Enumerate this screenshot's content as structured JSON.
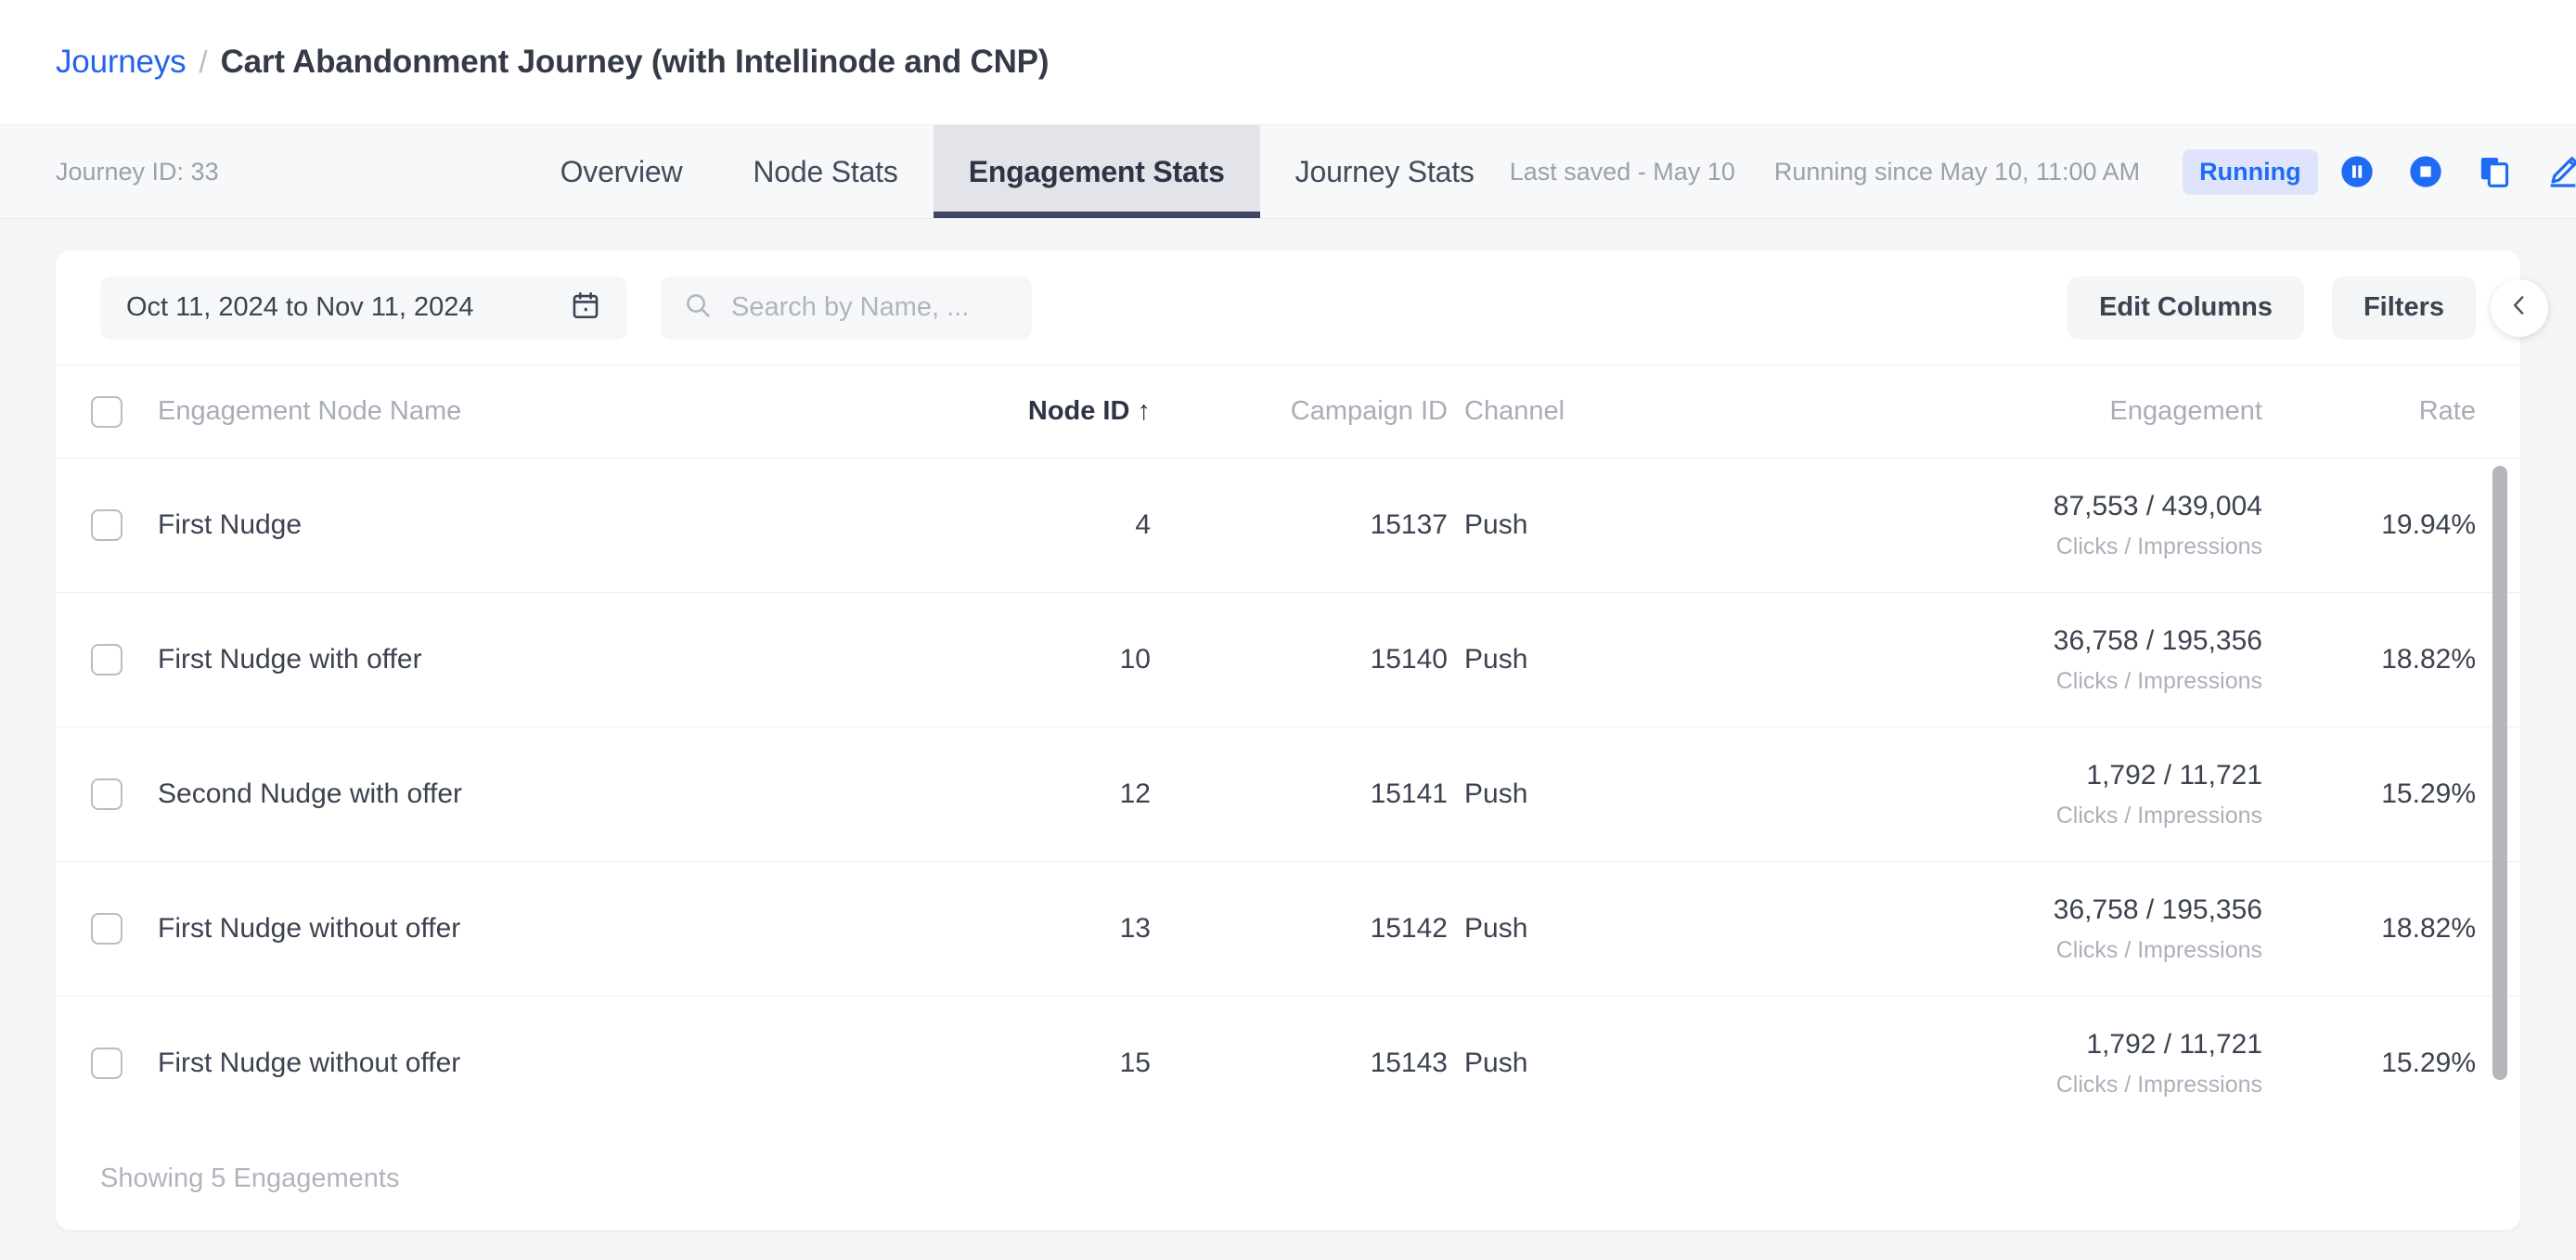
{
  "breadcrumb": {
    "parent": "Journeys",
    "separator": "/",
    "current": "Cart Abandonment Journey (with Intellinode and CNP)"
  },
  "tabbar": {
    "journey_id": "Journey ID: 33",
    "tabs": [
      {
        "label": "Overview",
        "active": false
      },
      {
        "label": "Node Stats",
        "active": false
      },
      {
        "label": "Engagement Stats",
        "active": true
      },
      {
        "label": "Journey Stats",
        "active": false
      }
    ],
    "last_saved": "Last saved - May 10",
    "running_since": "Running since May 10, 11:00 AM",
    "status": "Running",
    "status_bg": "#dfe4fc",
    "status_color": "#1f6bf3",
    "actions": [
      {
        "name": "pause-icon",
        "title": "Pause"
      },
      {
        "name": "stop-icon",
        "title": "Stop"
      },
      {
        "name": "duplicate-icon",
        "title": "Duplicate"
      },
      {
        "name": "edit-icon",
        "title": "Edit"
      }
    ],
    "action_color": "#1f6bf3"
  },
  "toolbar": {
    "date_range": "Oct 11, 2024 to Nov 11, 2024",
    "search_placeholder": "Search by Name, ...",
    "edit_columns": "Edit Columns",
    "filters": "Filters"
  },
  "table": {
    "headers": {
      "name": "Engagement Node Name",
      "node_id": "Node ID",
      "sort_arrow": "↑",
      "campaign_id": "Campaign ID",
      "channel": "Channel",
      "engagement": "Engagement",
      "rate": "Rate"
    },
    "engagement_sublabel": "Clicks / Impressions",
    "rows": [
      {
        "name": "First Nudge",
        "node_id": "4",
        "campaign_id": "15137",
        "channel": "Push",
        "engagement": "87,553 / 439,004",
        "engagement_sub": "Clicks / Impressions",
        "rate": "19.94%"
      },
      {
        "name": "First Nudge with offer",
        "node_id": "10",
        "campaign_id": "15140",
        "channel": "Push",
        "engagement": "36,758 / 195,356",
        "engagement_sub": "Clicks / Impressions",
        "rate": "18.82%"
      },
      {
        "name": "Second Nudge with offer",
        "node_id": "12",
        "campaign_id": "15141",
        "channel": "Push",
        "engagement": "1,792 / 11,721",
        "engagement_sub": "Clicks / Impressions",
        "rate": "15.29%"
      },
      {
        "name": "First Nudge without offer",
        "node_id": "13",
        "campaign_id": "15142",
        "channel": "Push",
        "engagement": "36,758 / 195,356",
        "engagement_sub": "Clicks / Impressions",
        "rate": "18.82%"
      },
      {
        "name": "First Nudge without offer",
        "node_id": "15",
        "campaign_id": "15143",
        "channel": "Push",
        "engagement": "1,792 / 11,721",
        "engagement_sub": "Clicks / Impressions",
        "rate": "15.29%"
      }
    ]
  },
  "footer": {
    "showing": "Showing 5 Engagements"
  }
}
